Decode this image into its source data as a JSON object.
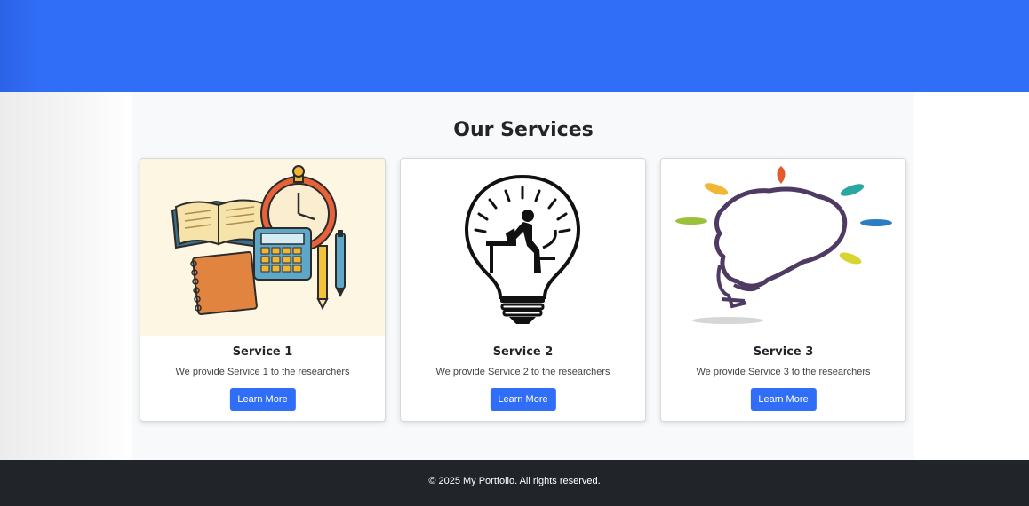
{
  "services": {
    "title": "Our Services",
    "cards": [
      {
        "title": "Service 1",
        "text": "We provide Service 1 to the researchers",
        "button": "Learn More",
        "image": "study-supplies-illustration"
      },
      {
        "title": "Service 2",
        "text": "We provide Service 2 to the researchers",
        "button": "Learn More",
        "image": "lightbulb-reader-illustration"
      },
      {
        "title": "Service 3",
        "text": "We provide Service 3 to the researchers",
        "button": "Learn More",
        "image": "brain-lightbulb-illustration"
      }
    ]
  },
  "footer": {
    "text": "© 2025 My Portfolio. All rights reserved."
  },
  "colors": {
    "primary": "#316ef7",
    "footer_bg": "#212529",
    "section_bg": "#f8f9fa"
  }
}
